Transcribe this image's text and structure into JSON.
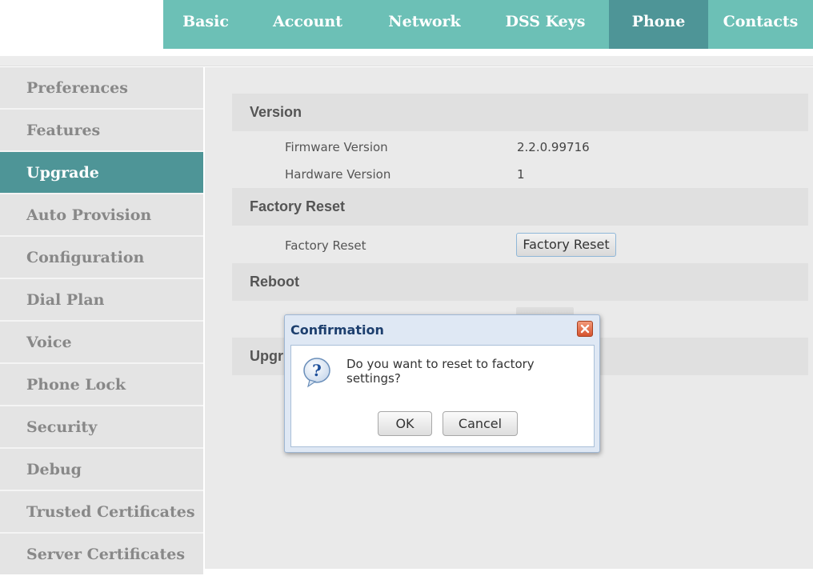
{
  "topnav": {
    "tabs": [
      {
        "label": "Basic",
        "active": false
      },
      {
        "label": "Account",
        "active": false
      },
      {
        "label": "Network",
        "active": false
      },
      {
        "label": "DSS Keys",
        "active": false
      },
      {
        "label": "Phone",
        "active": true
      },
      {
        "label": "Contacts",
        "active": false
      }
    ]
  },
  "sidebar": {
    "items": [
      {
        "label": "Preferences",
        "active": false
      },
      {
        "label": "Features",
        "active": false
      },
      {
        "label": "Upgrade",
        "active": true
      },
      {
        "label": "Auto Provision",
        "active": false
      },
      {
        "label": "Configuration",
        "active": false
      },
      {
        "label": "Dial Plan",
        "active": false
      },
      {
        "label": "Voice",
        "active": false
      },
      {
        "label": "Phone Lock",
        "active": false
      },
      {
        "label": "Security",
        "active": false
      },
      {
        "label": "Debug",
        "active": false
      },
      {
        "label": "Trusted Certificates",
        "active": false
      },
      {
        "label": "Server Certificates",
        "active": false
      }
    ]
  },
  "main": {
    "version": {
      "header": "Version",
      "firmware_label": "Firmware Version",
      "firmware_value": "2.2.0.99716",
      "hardware_label": "Hardware Version",
      "hardware_value": "1"
    },
    "factory_reset": {
      "header": "Factory Reset",
      "label": "Factory Reset",
      "button": "Factory Reset"
    },
    "reboot": {
      "header": "Reboot"
    },
    "upgrade": {
      "header": "Upgr"
    }
  },
  "dialog": {
    "title": "Confirmation",
    "message": "Do you want to reset to factory settings?",
    "ok_label": "OK",
    "cancel_label": "Cancel"
  },
  "colors": {
    "nav_bg": "#6cc0b6",
    "active_bg": "#4e9597",
    "dialog_title": "#1d3f6e"
  }
}
